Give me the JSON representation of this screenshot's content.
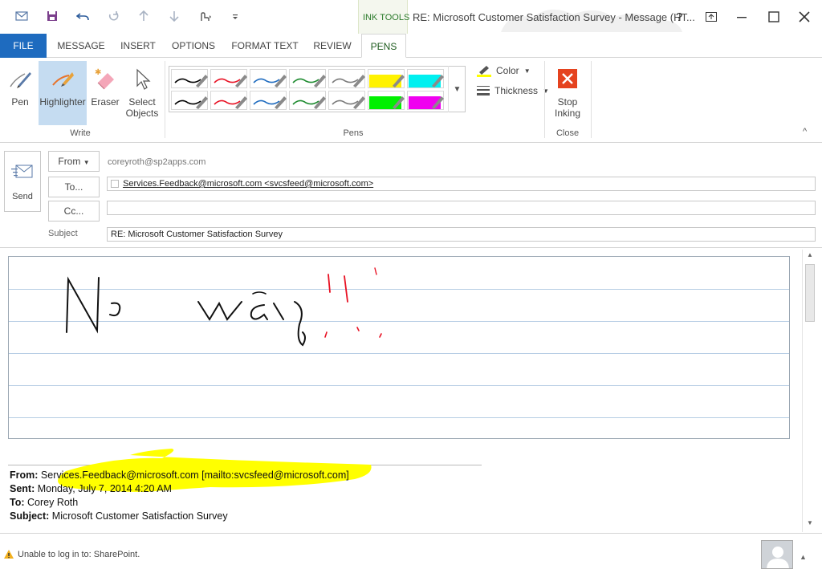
{
  "title_bar": {
    "context_tab": "INK TOOLS",
    "window_title": "RE: Microsoft Customer Satisfaction Survey - Message (HT...",
    "help": "?",
    "qat_icons": [
      "new-message-icon",
      "save-icon",
      "undo-icon",
      "redo-icon",
      "up-arrow-icon",
      "down-arrow-icon",
      "touch-mode-icon",
      "customize-icon"
    ]
  },
  "tabs": [
    "FILE",
    "MESSAGE",
    "INSERT",
    "OPTIONS",
    "FORMAT TEXT",
    "REVIEW",
    "PENS"
  ],
  "ribbon": {
    "write_group": {
      "label": "Write",
      "pen": "Pen",
      "highlighter": "Highlighter",
      "eraser": "Eraser",
      "select_objects_line1": "Select",
      "select_objects_line2": "Objects"
    },
    "pens_group": {
      "label": "Pens",
      "pens": [
        {
          "color": "#000000",
          "type": "pen"
        },
        {
          "color": "#e81123",
          "type": "pen"
        },
        {
          "color": "#1e6bbf",
          "type": "pen"
        },
        {
          "color": "#1c8a2e",
          "type": "pen"
        },
        {
          "color": "#7a7a7a",
          "type": "pen"
        },
        {
          "color": "#fff200",
          "type": "highlighter"
        },
        {
          "color": "#00f0f0",
          "type": "highlighter"
        },
        {
          "color": "#000000",
          "type": "pen"
        },
        {
          "color": "#e81123",
          "type": "pen"
        },
        {
          "color": "#1e6bbf",
          "type": "pen"
        },
        {
          "color": "#1c8a2e",
          "type": "pen"
        },
        {
          "color": "#7a7a7a",
          "type": "pen"
        },
        {
          "color": "#00f000",
          "type": "highlighter"
        },
        {
          "color": "#f000f0",
          "type": "highlighter"
        }
      ],
      "color_label": "Color",
      "thickness_label": "Thickness"
    },
    "close_group": {
      "label": "Close",
      "stop_line1": "Stop",
      "stop_line2": "Inking"
    }
  },
  "compose": {
    "send_label": "Send",
    "from_button": "From",
    "from_value": "coreyroth@sp2apps.com",
    "to_button": "To...",
    "to_value": "Services.Feedback@microsoft.com <svcsfeed@microsoft.com>",
    "cc_button": "Cc...",
    "cc_value": "",
    "subject_label": "Subject",
    "subject_value": "RE: Microsoft Customer Satisfaction Survey"
  },
  "quoted": {
    "from_label": "From:",
    "from_value": "Services.Feedback@microsoft.com [mailto:svcsfeed@microsoft.com]",
    "sent_label": "Sent:",
    "sent_value": "Monday, July 7, 2014 4:20 AM",
    "to_label": "To:",
    "to_value": "Corey Roth",
    "subject_label": "Subject:",
    "subject_value": "Microsoft Customer Satisfaction Survey"
  },
  "status": {
    "message": "Unable to log in to: SharePoint."
  },
  "colors": {
    "file_tab": "#1e6bbf",
    "highlight_selected": "#c5dcf1",
    "stop_inking": "#e5431f",
    "ink_yellow": "#ffff00",
    "ink_red": "#e81123"
  }
}
